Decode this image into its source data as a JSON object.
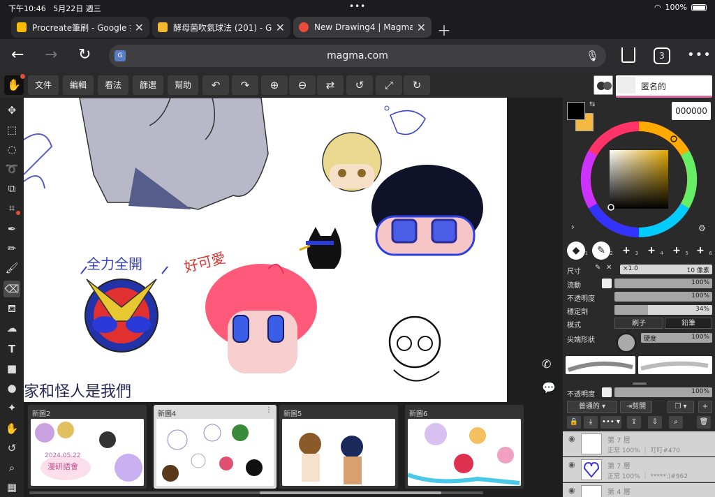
{
  "status": {
    "time": "下午10:46",
    "date": "5月22日 週三",
    "dots": "•••",
    "battery": "100%"
  },
  "tabs": [
    {
      "title": "Procreate筆刷 - Google 搜",
      "color": "#fbbc05"
    },
    {
      "title": "酵母菌吹氣球法 (201) - Go",
      "color": "#f5b82e"
    },
    {
      "title": "New Drawing4 | Magma",
      "color": "#e94c3c"
    }
  ],
  "address": {
    "url": "magma.com",
    "tab_count": "3"
  },
  "menu": [
    "文件",
    "編輯",
    "看法",
    "篩選",
    "幫助"
  ],
  "user": {
    "name": "匿名的"
  },
  "color": {
    "hex": "000000",
    "primary": "#000000",
    "secondary": "#f5b942"
  },
  "brushes": [
    {
      "glyph": "◆",
      "n": "1"
    },
    {
      "glyph": "✎",
      "n": "2"
    },
    {
      "glyph": "+",
      "n": "3"
    },
    {
      "glyph": "+",
      "n": "4"
    },
    {
      "glyph": "+",
      "n": "5"
    },
    {
      "glyph": "+",
      "n": "6"
    }
  ],
  "props": {
    "size_label": "尺寸",
    "size_mult": "×1.0",
    "size_val": "10 像素",
    "flow_label": "流動",
    "flow_val": "100%",
    "flow": 1.0,
    "opacity_label": "不透明度",
    "opacity_val": "100%",
    "opacity": 1.0,
    "stab_label": "穩定劑",
    "stab_val": "34%",
    "stab": 0.34,
    "mode_label": "模式",
    "mode_brush": "刷子",
    "mode_pencil": "鉛筆",
    "tip_label": "尖端形狀",
    "hard_label": "硬度",
    "hard_val": "100%",
    "hard": 1.0,
    "layer_opacity_label": "不透明度",
    "layer_opacity_val": "100%",
    "layer_opacity": 1.0,
    "blend": "普通的 ▾",
    "clip": "⇥剪開"
  },
  "layers": [
    {
      "name": "第 7 層",
      "info": "正常 100% ｜ 叮叮#470"
    },
    {
      "name": "第 7 層",
      "info": "正常 100% ｜ *****:)#962"
    },
    {
      "name": "第 4 層",
      "info": ""
    }
  ],
  "drawings": [
    {
      "label": "新圖2"
    },
    {
      "label": "新圖4"
    },
    {
      "label": "新圖5"
    },
    {
      "label": "新圖6"
    }
  ],
  "canvas_text": {
    "full_open": "全力全開",
    "cute": "好可愛",
    "bottom": "家和怪人是我們",
    "thumb_date": "2024.05.22",
    "thumb_text": "漫研語會"
  },
  "ui": {
    "more": "⋮",
    "phone": "✆",
    "chat": "💬"
  }
}
